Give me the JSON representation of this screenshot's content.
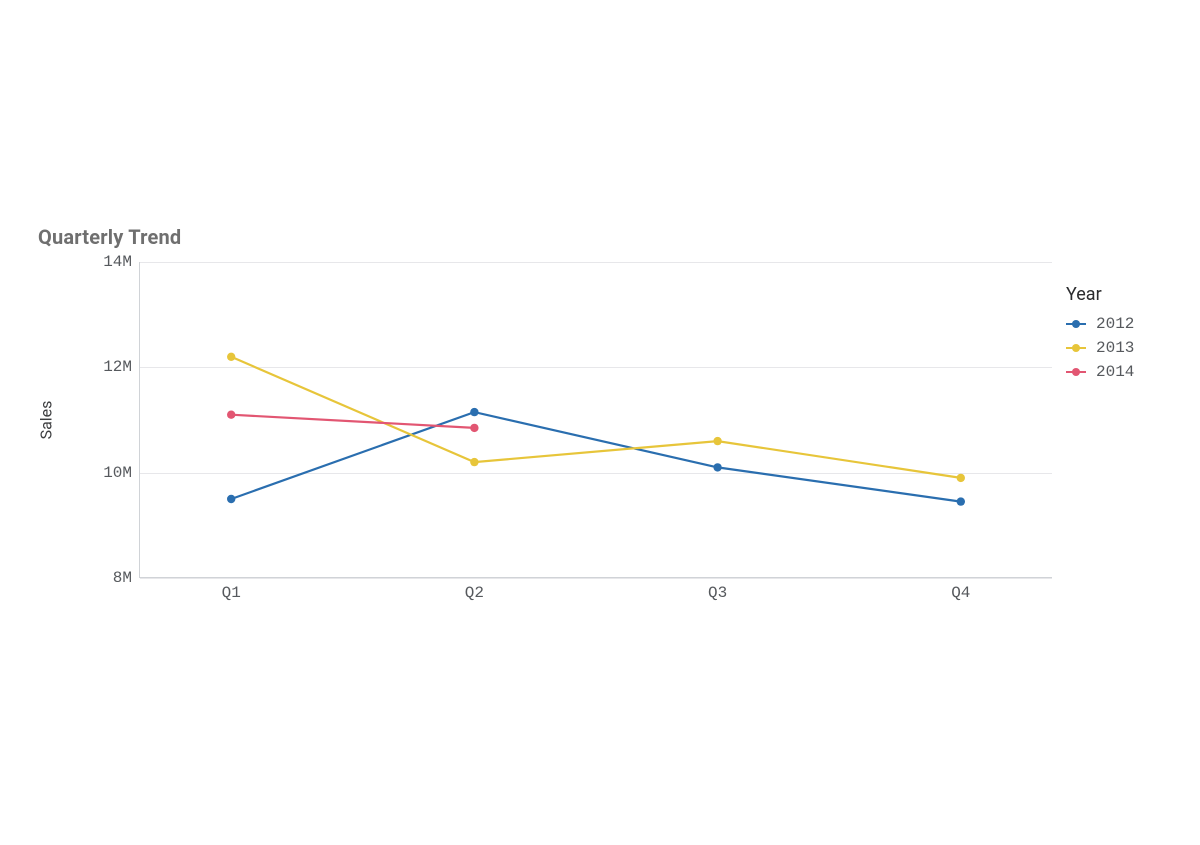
{
  "chart_data": {
    "type": "line",
    "title": "Quarterly Trend",
    "xlabel": "",
    "ylabel": "Sales",
    "categories": [
      "Q1",
      "Q2",
      "Q3",
      "Q4"
    ],
    "ylim": [
      8000000,
      14000000
    ],
    "y_ticks": [
      8000000,
      10000000,
      12000000,
      14000000
    ],
    "y_tick_labels": [
      "8M",
      "10M",
      "12M",
      "14M"
    ],
    "series": [
      {
        "name": "2012",
        "color": "#2a6eaf",
        "values": [
          9500000,
          11150000,
          10100000,
          9450000
        ]
      },
      {
        "name": "2013",
        "color": "#e7c53a",
        "values": [
          12200000,
          10200000,
          10600000,
          9900000
        ]
      },
      {
        "name": "2014",
        "color": "#e25672",
        "values": [
          11100000,
          10850000,
          null,
          null
        ]
      }
    ],
    "legend_title": "Year",
    "legend_position": "right",
    "grid": true
  }
}
